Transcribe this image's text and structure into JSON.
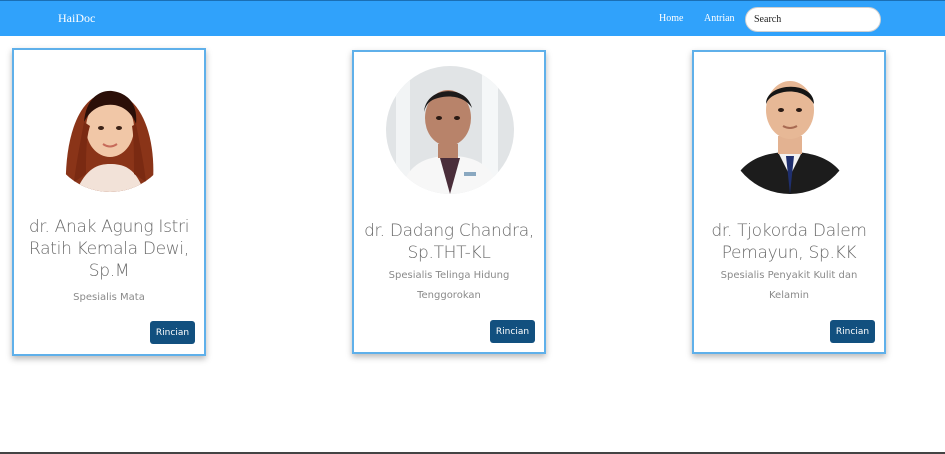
{
  "navbar": {
    "brand": "HaiDoc",
    "links": [
      "Home",
      "Antrian"
    ],
    "search_placeholder": "Search",
    "color": "#30a2fb"
  },
  "doctors": [
    {
      "name": "dr. Anak Agung Istri Ratih Kemala Dewi, Sp.M",
      "specialty": "Spesialis Mata",
      "button": "Rincian"
    },
    {
      "name": "dr. Dadang Chandra, Sp.THT-KL",
      "specialty": "Spesialis Telinga Hidung Tenggorokan",
      "button": "Rincian"
    },
    {
      "name": "dr. Tjokorda Dalem Pemayun, Sp.KK",
      "specialty": "Spesialis Penyakit Kulit dan Kelamin",
      "button": "Rincian"
    }
  ],
  "colors": {
    "card_border": "#5fb0ea",
    "button": "#12507f"
  }
}
